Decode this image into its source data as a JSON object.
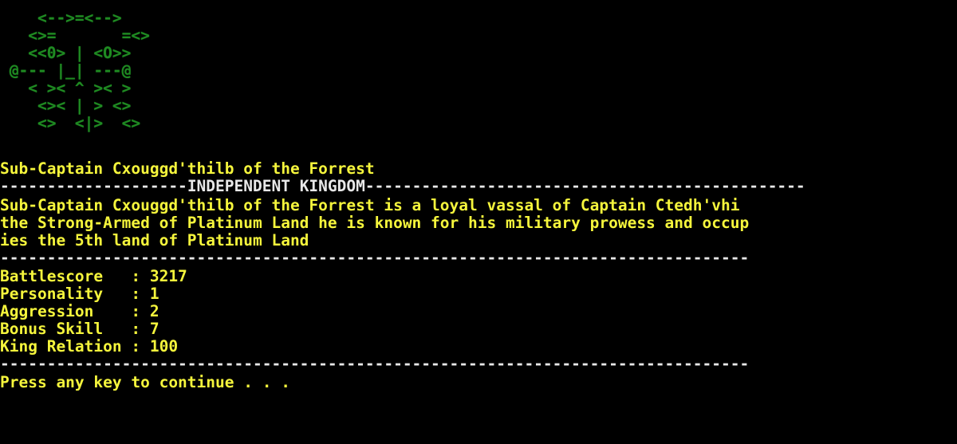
{
  "screen": {
    "background_color": "#000000",
    "ascii_color": "#1f8b22",
    "text_color": "#f5f53c",
    "rule_color": "#e8e8e8",
    "columns": 80
  },
  "ascii_art": {
    "name": "crest-banner",
    "lines": [
      "    <-->=<-->",
      "   <>=       =<>",
      "   <<0> | <O>>",
      " @--- |_| ---@",
      "   < >< ^ >< >",
      "    <>< | > <>",
      "    <>  <|>  <>"
    ]
  },
  "header": {
    "title": "Sub-Captain Cxouggd'thilb of the Forrest"
  },
  "kingdom_banner": {
    "label": "INDEPENDENT KINGDOM",
    "left_dashes": "--------------------",
    "right_dashes": "-----------------------------------------------"
  },
  "description": {
    "lines": [
      "Sub-Captain Cxouggd'thilb of the Forrest is a loyal vassal of Captain Ctedh'vhi",
      "the Strong-Armed of Platinum Land he is known for his military prowess and occup",
      "ies the 5th land of Platinum Land"
    ]
  },
  "rules": {
    "full_line": "--------------------------------------------------------------------------------"
  },
  "stats": {
    "rows": [
      {
        "label": "Battlescore",
        "separator": ":",
        "value": "3217"
      },
      {
        "label": "Personality",
        "separator": ":",
        "value": "1"
      },
      {
        "label": "Aggression",
        "separator": ":",
        "value": "2"
      },
      {
        "label": "Bonus Skill",
        "separator": ":",
        "value": "7"
      },
      {
        "label": "King Relation",
        "separator": ":",
        "value": "100"
      }
    ],
    "formatted_lines": [
      "Battlescore   : 3217",
      "Personality   : 1",
      "Aggression    : 2",
      "Bonus Skill   : 7",
      "King Relation : 100"
    ]
  },
  "footer": {
    "prompt": "Press any key to continue . . ."
  }
}
